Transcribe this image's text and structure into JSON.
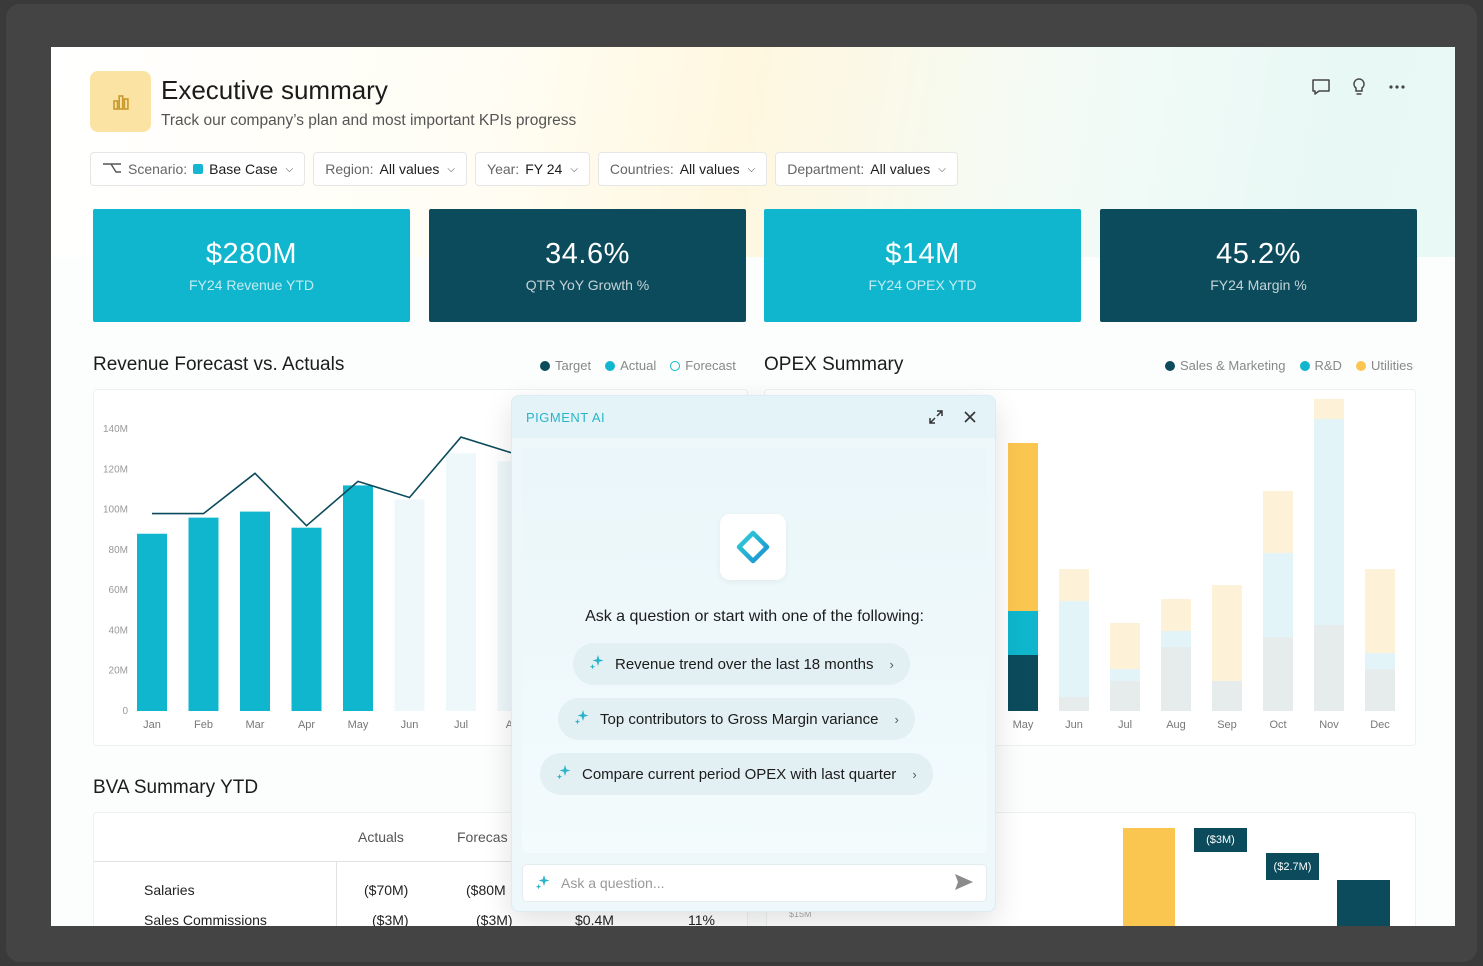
{
  "header": {
    "title": "Executive summary",
    "subtitle": "Track our company’s plan and most important KPIs progress"
  },
  "filters": [
    {
      "label": "Scenario:",
      "value": "Base Case"
    },
    {
      "label": "Region:",
      "value": "All values"
    },
    {
      "label": "Year:",
      "value": "FY 24"
    },
    {
      "label": "Countries:",
      "value": "All values"
    },
    {
      "label": "Department:",
      "value": "All values"
    }
  ],
  "kpis": [
    {
      "value": "$280M",
      "label": "FY24 Revenue YTD"
    },
    {
      "value": "34.6%",
      "label": "QTR YoY Growth %"
    },
    {
      "value": "$14M",
      "label": "FY24 OPEX YTD"
    },
    {
      "value": "45.2%",
      "label": "FY24 Margin %"
    }
  ],
  "revenue_chart": {
    "title": "Revenue Forecast vs. Actuals",
    "legend": [
      {
        "name": "Target",
        "color": "#0b4b5c"
      },
      {
        "name": "Actual",
        "color": "#0fb6cd"
      },
      {
        "name": "Forecast",
        "color": "#0fb6cd"
      }
    ]
  },
  "opex_chart": {
    "title": "OPEX Summary",
    "legend": [
      {
        "name": "Sales & Marketing",
        "color": "#0b4b5c"
      },
      {
        "name": "R&D",
        "color": "#0fb6cd"
      },
      {
        "name": "Utilities",
        "color": "#fbc64f"
      }
    ]
  },
  "chart_data": [
    {
      "type": "bar",
      "title": "Revenue Forecast vs. Actuals",
      "categories": [
        "Jan",
        "Feb",
        "Mar",
        "Apr",
        "May",
        "Jun",
        "Jul",
        "Au"
      ],
      "yticks": [
        "0",
        "20M",
        "40M",
        "60M",
        "80M",
        "100M",
        "120M",
        "140M"
      ],
      "ylim": [
        0,
        140
      ],
      "series": [
        {
          "name": "Actual",
          "values": [
            88,
            96,
            99,
            91,
            112,
            null,
            null,
            null
          ]
        },
        {
          "name": "Forecast",
          "values": [
            null,
            null,
            null,
            null,
            null,
            105,
            128,
            124
          ]
        },
        {
          "name": "Target",
          "values": [
            98,
            98,
            118,
            92,
            114,
            106,
            136,
            128
          ]
        }
      ]
    },
    {
      "type": "bar",
      "title": "OPEX Summary",
      "categories": [
        "May",
        "Jun",
        "Jul",
        "Aug",
        "Sep",
        "Oct",
        "Nov",
        "Dec"
      ],
      "series": [
        {
          "name": "Sales & Marketing",
          "values": [
            56,
            14,
            30,
            64,
            30,
            74,
            86,
            42
          ]
        },
        {
          "name": "R&D",
          "values": [
            44,
            96,
            12,
            16,
            0,
            84,
            206,
            16
          ]
        },
        {
          "name": "Utilities",
          "values": [
            168,
            32,
            46,
            32,
            96,
            62,
            20,
            84
          ]
        }
      ]
    }
  ],
  "bva": {
    "title": "BVA Summary YTD",
    "headers": [
      "Actuals",
      "Forecas"
    ],
    "rows": [
      {
        "name": "Salaries",
        "actuals": "($70M)",
        "forecast": "($80M",
        "var": "",
        "pct": ""
      },
      {
        "name": "Sales Commissions",
        "actuals": "($3M)",
        "forecast": "($3M)",
        "var": "$0.4M",
        "pct": "11%"
      }
    ]
  },
  "waterfall": {
    "labels": [
      "($3M)",
      "($2.7M)"
    ],
    "axis_label": "$15M"
  },
  "ai_panel": {
    "title": "PIGMENT AI",
    "prompt": "Ask a question or start with one of the following:",
    "suggestions": [
      "Revenue trend over the last 18 months",
      "Top contributors to Gross Margin variance",
      "Compare current period OPEX with last quarter"
    ],
    "input_placeholder": "Ask a question..."
  }
}
